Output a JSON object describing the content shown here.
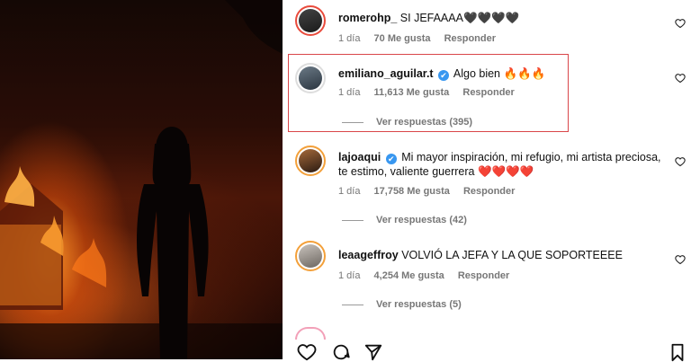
{
  "comments": [
    {
      "username": "romerohp_",
      "verified": false,
      "text": "SI JEFAAAA🖤🖤🖤🖤",
      "age": "1 día",
      "likes": "70 Me gusta",
      "reply": "Responder",
      "replies": ""
    },
    {
      "username": "emiliano_aguilar.t",
      "verified": true,
      "text": "Algo bien 🔥🔥🔥",
      "age": "1 día",
      "likes": "11,613 Me gusta",
      "reply": "Responder",
      "replies": "Ver respuestas (395)"
    },
    {
      "username": "lajoaqui",
      "verified": true,
      "text": "Mi mayor inspiración, mi refugio, mi artista preciosa, te estimo, valiente guerrera ❤️❤️❤️❤️",
      "age": "1 día",
      "likes": "17,758 Me gusta",
      "reply": "Responder",
      "replies": "Ver respuestas (42)"
    },
    {
      "username": "leaageffroy",
      "verified": false,
      "text": "VOLVIÓ LA JEFA Y LA QUE SOPORTEEEE",
      "age": "1 día",
      "likes": "4,254 Me gusta",
      "reply": "Responder",
      "replies": "Ver respuestas (5)"
    }
  ],
  "icons": {
    "verified": "✔",
    "like": "heart-icon",
    "comment": "comment-icon",
    "share": "send-icon",
    "save": "bookmark-icon"
  },
  "colors": {
    "highlight": "#d9464a",
    "verified": "#3897f0",
    "meta": "#777777"
  }
}
